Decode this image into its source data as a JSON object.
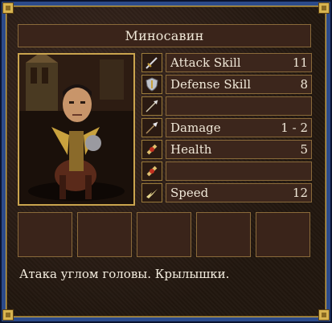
{
  "window": {
    "title": "Миносавин"
  },
  "portrait": {
    "name": "creature-portrait"
  },
  "stats": [
    {
      "icon": "sword-icon",
      "label": "Attack Skill",
      "value": "11"
    },
    {
      "icon": "shield-icon",
      "label": "Defense Skill",
      "value": "8"
    },
    {
      "icon": "arrow-icon",
      "label": "",
      "value": ""
    },
    {
      "icon": "spear-icon",
      "label": "Damage",
      "value": "1 - 2"
    },
    {
      "icon": "health-icon",
      "label": "Health",
      "value": "5"
    },
    {
      "icon": "health-icon",
      "label": "",
      "value": ""
    },
    {
      "icon": "speed-icon",
      "label": "Speed",
      "value": "12"
    }
  ],
  "description": "Атака углом головы. Крылышки.",
  "colors": {
    "frame_blue": "#2b4a8a",
    "gold": "#caa44e",
    "panel": "#3c261c",
    "text": "#f0e8d8"
  }
}
